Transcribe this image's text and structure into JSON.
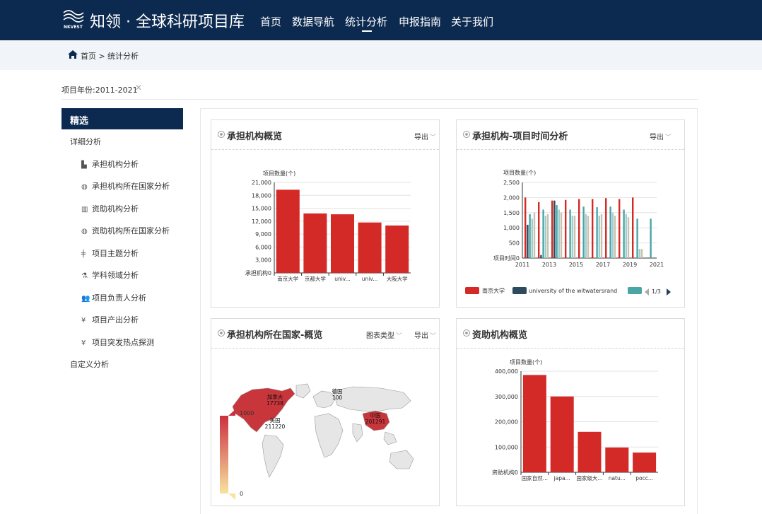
{
  "header": {
    "logo_text": "NKVEST",
    "site_title": "知领 · 全球科研项目库",
    "nav": [
      "首页",
      "数据导航",
      "统计分析",
      "申报指南",
      "关于我们"
    ],
    "active_nav": "统计分析"
  },
  "breadcrumb": {
    "home": "首页 >",
    "current": "统计分析"
  },
  "filter": {
    "label": "项目年份:2011-2021"
  },
  "sidebar": {
    "header": "精选",
    "group1": "详细分析",
    "items": [
      {
        "label": "承担机构分析",
        "icon": "building-icon"
      },
      {
        "label": "承担机构所在国家分析",
        "icon": "globe-icon"
      },
      {
        "label": "资助机构分析",
        "icon": "bank-icon"
      },
      {
        "label": "资助机构所在国家分析",
        "icon": "globe-icon"
      },
      {
        "label": "项目主题分析",
        "icon": "topic-icon"
      },
      {
        "label": "学科领域分析",
        "icon": "flask-icon"
      },
      {
        "label": "项目负责人分析",
        "icon": "users-icon"
      },
      {
        "label": "项目产出分析",
        "icon": "yen-icon"
      },
      {
        "label": "项目突发热点探测",
        "icon": "yen-icon"
      }
    ],
    "group2": "自定义分析"
  },
  "cards": {
    "c1": {
      "title": "承担机构概览",
      "export": "导出"
    },
    "c2": {
      "title": "承担机构-项目时间分析",
      "export": "导出"
    },
    "c3": {
      "title": "承担机构所在国家-概览",
      "chart_type": "图表类型",
      "export": "导出"
    },
    "c4": {
      "title": "资助机构概览",
      "export": "导出"
    }
  },
  "chart_data": [
    {
      "type": "bar",
      "title": "承担机构概览",
      "ylabel": "项目数量(个)",
      "xlabel": "承担机构",
      "categories": [
        "南京大学",
        "京都大学",
        "univ...",
        "univ...",
        "大阪大学"
      ],
      "values": [
        19300,
        13800,
        13600,
        11700,
        11000
      ],
      "ylim": [
        0,
        21000
      ],
      "yticks": [
        0,
        3000,
        6000,
        9000,
        12000,
        15000,
        18000,
        21000
      ],
      "ytick_labels": [
        "0",
        "3,000",
        "6,000",
        "9,000",
        "12,000",
        "15,000",
        "18,000",
        "21,000"
      ],
      "color": "#d42a27",
      "grid": true
    },
    {
      "type": "bar",
      "title": "承担机构-项目时间分析",
      "ylabel": "项目数量(个)",
      "xlabel": "项目时间",
      "x": [
        2011,
        2012,
        2013,
        2014,
        2015,
        2016,
        2017,
        2018,
        2019,
        2020
      ],
      "x_tick_labels": [
        "2011",
        "2013",
        "2015",
        "2017",
        "2019",
        "2021"
      ],
      "ylim": [
        0,
        2500
      ],
      "yticks": [
        0,
        500,
        1000,
        1500,
        2000,
        2500
      ],
      "ytick_labels": [
        "0",
        "500",
        "1,000",
        "1,500",
        "2,000",
        "2,500"
      ],
      "series": [
        {
          "name": "南京大学",
          "color": "#d42a27",
          "values": [
            2000,
            1850,
            1900,
            1920,
            1950,
            1950,
            1980,
            1950,
            2000,
            0
          ]
        },
        {
          "name": "university of the witwatersrand",
          "color": "#2e4a5e",
          "values": [
            1100,
            100,
            1900,
            0,
            0,
            0,
            0,
            0,
            0,
            0
          ]
        },
        {
          "color": "#4aa5a6",
          "values": [
            1450,
            1600,
            1750,
            1600,
            1700,
            1680,
            1700,
            1600,
            1300,
            1300
          ]
        },
        {
          "color": "#9ecfce",
          "values": [
            1300,
            1400,
            1600,
            1400,
            1450,
            1400,
            1500,
            1450,
            300,
            0
          ]
        },
        {
          "color": "#cdbfae",
          "values": [
            1500,
            1450,
            1500,
            1400,
            1400,
            1450,
            1400,
            1350,
            300,
            0
          ]
        }
      ],
      "legend": {
        "placement": "bottom",
        "page": "1/3"
      },
      "grid": true
    },
    {
      "type": "map",
      "title": "承担机构所在国家-概览",
      "regions": [
        {
          "name": "美国",
          "value": "211220"
        },
        {
          "name": "中国",
          "value": "201291"
        },
        {
          "name": "加拿大",
          "value": "17738"
        },
        {
          "name": "德国",
          "value": "100"
        }
      ],
      "visual_map": {
        "min": "0",
        "max": "1000",
        "colors": [
          "#f7e3a0",
          "#cc3040"
        ]
      }
    },
    {
      "type": "bar",
      "title": "资助机构概览",
      "ylabel": "项目数量(个)",
      "xlabel": "资助机构",
      "categories": [
        "国家自然...",
        "japa...",
        "国家级大...",
        "natu...",
        "pocc..."
      ],
      "values": [
        385000,
        300000,
        160000,
        98000,
        78000
      ],
      "ylim": [
        0,
        400000
      ],
      "yticks": [
        0,
        100000,
        200000,
        300000,
        400000
      ],
      "ytick_labels": [
        "0",
        "100,000",
        "200,000",
        "300,000",
        "400,000"
      ],
      "color": "#d42a27",
      "grid": true
    }
  ]
}
